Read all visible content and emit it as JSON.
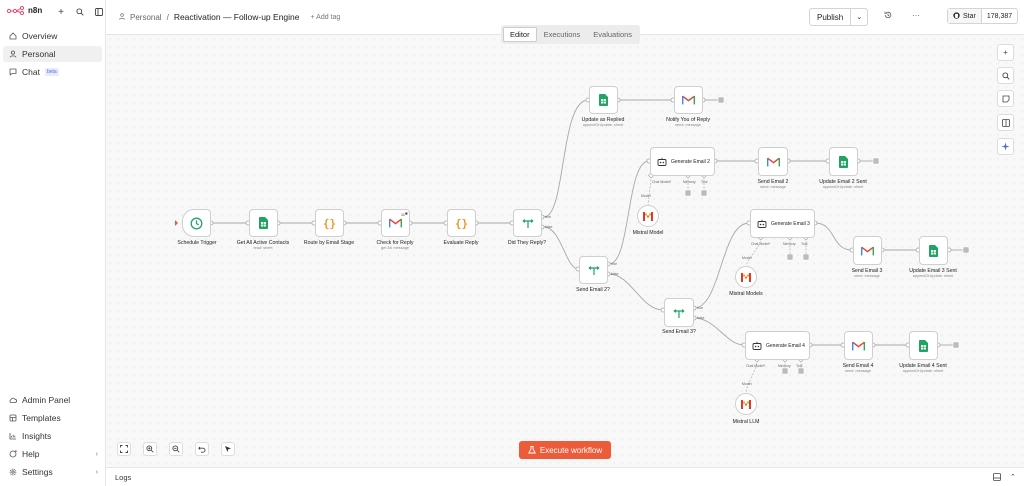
{
  "app": {
    "name": "n8n"
  },
  "sidebar": {
    "items": [
      {
        "label": "Overview",
        "icon": "home-icon"
      },
      {
        "label": "Personal",
        "icon": "user-icon"
      },
      {
        "label": "Chat",
        "icon": "chat-icon",
        "badge": "beta"
      }
    ],
    "bottom": [
      {
        "label": "Admin Panel"
      },
      {
        "label": "Templates"
      },
      {
        "label": "Insights"
      },
      {
        "label": "Help"
      },
      {
        "label": "Settings"
      }
    ]
  },
  "header": {
    "project": "Personal",
    "separator": "/",
    "workflow_title": "Reactivation — Follow-up Engine",
    "add_tag": "+ Add tag",
    "publish": "Publish",
    "star": "Star",
    "star_count": "178,387"
  },
  "tabs": [
    "Editor",
    "Executions",
    "Evaluations"
  ],
  "nodes": {
    "schedule": {
      "label": "Schedule Trigger"
    },
    "get_contacts": {
      "label": "Get All Active Contacts",
      "sub": "read: sheet"
    },
    "route": {
      "label": "Route by Email Stage"
    },
    "check_reply": {
      "label": "Check for Reply",
      "sub": "get All: message",
      "badge": "11"
    },
    "evaluate": {
      "label": "Evaluate Reply"
    },
    "did_reply": {
      "label": "Did They Reply?",
      "true_label": "true",
      "false_label": "false"
    },
    "update_replied": {
      "label": "Update as Replied",
      "sub": "appendOrUpdate: sheet"
    },
    "notify": {
      "label": "Notify You of Reply",
      "sub": "send: message"
    },
    "send2q": {
      "label": "Send Email 2?",
      "true_label": "true",
      "false_label": "false"
    },
    "gen2": {
      "label": "Generate Email 2",
      "chat": "Chat Model*",
      "memory": "Memory",
      "tool": "Tool",
      "model_label": "Model"
    },
    "send2": {
      "label": "Send Email 2",
      "sub": "send: message"
    },
    "update2": {
      "label": "Update Email 2 Sent",
      "sub": "appendOrUpdate: sheet"
    },
    "mistral1": {
      "label": "Mistral Model"
    },
    "send3q": {
      "label": "Send Email 3?",
      "true_label": "true",
      "false_label": "false"
    },
    "gen3": {
      "label": "Generate Email 3",
      "chat": "Chat Model*",
      "memory": "Memory",
      "tool": "Tool",
      "model_label": "Model"
    },
    "send3": {
      "label": "Send Email 3",
      "sub": "send: message"
    },
    "update3": {
      "label": "Update Email 3 Sent",
      "sub": "appendOrUpdate: sheet"
    },
    "mistral2": {
      "label": "Mistral Models"
    },
    "gen4": {
      "label": "Generate Email 4",
      "chat": "Chat Model*",
      "memory": "Memory",
      "tool": "Tool",
      "model_label": "Model"
    },
    "send4": {
      "label": "Send Email 4",
      "sub": "send: message"
    },
    "update4": {
      "label": "Update Email 4 Sent",
      "sub": "appendOrUpdate: sheet"
    },
    "mistral3": {
      "label": "Mistral LLM"
    }
  },
  "execute_button": "Execute workflow",
  "footer": {
    "logs": "Logs"
  },
  "colors": {
    "accent": "#ec5b3a",
    "sheets": "#1fa463",
    "gmail_red": "#ea4335",
    "if_green": "#1fa463",
    "code_orange": "#f0962e"
  }
}
